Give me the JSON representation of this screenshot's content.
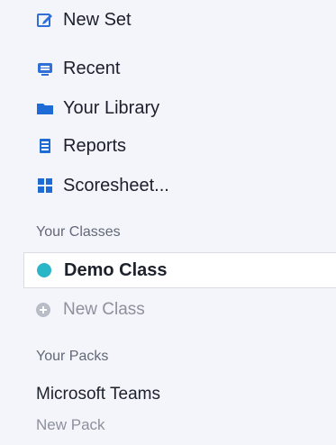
{
  "nav": {
    "new_set": "New Set",
    "recent": "Recent",
    "library": "Your Library",
    "reports": "Reports",
    "scoresheet": "Scoresheet..."
  },
  "classes": {
    "heading": "Your Classes",
    "items": [
      {
        "label": "Demo Class",
        "selected": true,
        "color": "#2ab6c6"
      }
    ],
    "add_label": "New Class"
  },
  "packs": {
    "heading": "Your Packs",
    "items": [
      {
        "label": "Microsoft Teams"
      }
    ],
    "add_label": "New Pack"
  },
  "colors": {
    "accent": "#2f6fd6",
    "sidebar_bg": "#f4f5fa",
    "class_dot": "#2ab6c6"
  },
  "icons": {
    "new_set": "edit-square-icon",
    "recent": "monitor-icon",
    "library": "folder-icon",
    "reports": "document-list-icon",
    "scoresheet": "grid-icon",
    "new_class": "plus-circle-icon"
  }
}
